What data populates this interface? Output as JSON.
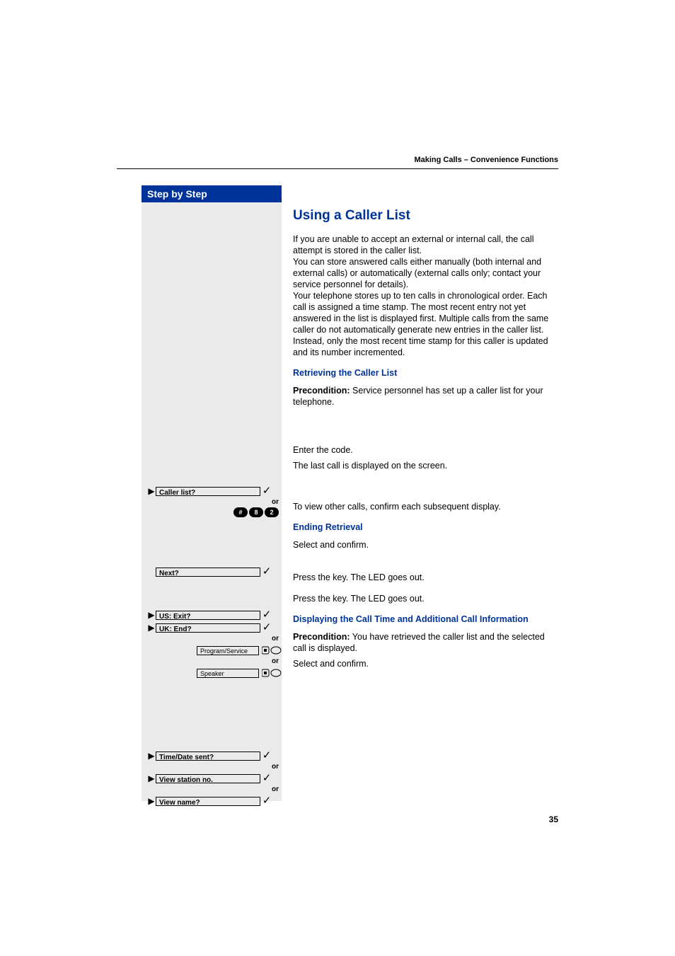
{
  "running_head": "Making Calls – Convenience Functions",
  "page_number": "35",
  "sidebar": {
    "title": "Step by Step",
    "items": {
      "caller_list": "Caller list?",
      "next": "Next?",
      "us_exit": "US: Exit?",
      "uk_end": "UK: End?",
      "program_service": "Program/Service",
      "speaker": "Speaker",
      "time_date": "Time/Date sent?",
      "view_station": "View station no.",
      "view_name": "View name?"
    },
    "or": "or",
    "code": {
      "k1": "#",
      "k2": "8",
      "k3": "2"
    }
  },
  "main": {
    "h2": "Using a Caller List",
    "p1": "If you are unable to accept an external or internal call, the call attempt is stored in the caller list.",
    "p2": "You can store answered calls either manually (both internal and external calls) or automatically (external calls only; contact your service personnel for details).",
    "p3": "Your telephone stores up to ten calls in chronological order. Each call is assigned a time stamp. The most recent entry not yet answered in the list is displayed first. Multiple calls from the same caller do not automatically generate new entries in the caller list. Instead, only the most recent time stamp for this caller is updated and its number incremented.",
    "h3a": "Retrieving the Caller List",
    "pre1_label": "Precondition:",
    "pre1_text": " Service personnel has set up a caller list for your telephone.",
    "enter_code": "Enter the code.",
    "last_call": "The last call is displayed on the screen.",
    "view_other": "To view other calls, confirm each subsequent display.",
    "h3b": "Ending Retrieval",
    "select_confirm": "Select and confirm.",
    "press_led1": "Press the key. The LED goes out.",
    "press_led2": "Press the key. The LED goes out.",
    "h3c": "Displaying the Call Time and Additional Call Information",
    "pre2_label": "Precondition:",
    "pre2_text": " You have retrieved the caller list and the selected call is displayed.",
    "select_confirm2": "Select and confirm."
  }
}
